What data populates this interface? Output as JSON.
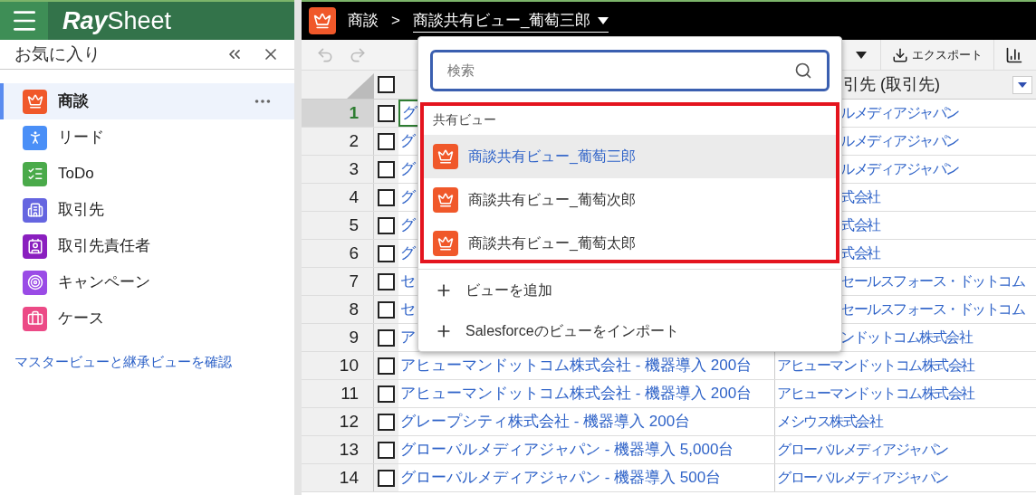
{
  "header": {
    "logo_bold": "Ray",
    "logo_light": "Sheet"
  },
  "sidebar": {
    "title": "お気に入り",
    "items": [
      {
        "label": "商談",
        "kind": "crown",
        "color": "#f0582a",
        "selected": true
      },
      {
        "label": "リード",
        "kind": "person",
        "color": "#4a8ff7",
        "selected": false
      },
      {
        "label": "ToDo",
        "kind": "checklist",
        "color": "#4aaa4a",
        "selected": false
      },
      {
        "label": "取引先",
        "kind": "building",
        "color": "#6565e0",
        "selected": false
      },
      {
        "label": "取引先責任者",
        "kind": "card",
        "color": "#8a1fbf",
        "selected": false
      },
      {
        "label": "キャンペーン",
        "kind": "target",
        "color": "#9a4be6",
        "selected": false
      },
      {
        "label": "ケース",
        "kind": "case",
        "color": "#ec4a86",
        "selected": false
      }
    ],
    "link": "マスタービューと継承ビューを確認"
  },
  "breadcrumb": {
    "object": "商談",
    "separator": ">",
    "view": "商談共有ビュー_葡萄三郎"
  },
  "toolbar": {
    "export": "エクスポート"
  },
  "grid": {
    "header_checked": false,
    "column_b": "引先 (取引先)",
    "rows": [
      {
        "number": "1",
        "selected": true,
        "checked": false,
        "cells": [
          "グ",
          "ルメディアジャパン"
        ]
      },
      {
        "number": "2",
        "selected": false,
        "checked": false,
        "cells": [
          "グ",
          "ルメディアジャパン"
        ]
      },
      {
        "number": "3",
        "selected": false,
        "checked": false,
        "cells": [
          "グ",
          "ルメディアジャパン"
        ]
      },
      {
        "number": "4",
        "selected": false,
        "checked": false,
        "cells": [
          "グ",
          "式会社"
        ]
      },
      {
        "number": "5",
        "selected": false,
        "checked": false,
        "cells": [
          "グ",
          "式会社"
        ]
      },
      {
        "number": "6",
        "selected": false,
        "checked": false,
        "cells": [
          "グ",
          "式会社"
        ]
      },
      {
        "number": "7",
        "selected": false,
        "checked": false,
        "cells": [
          "セ",
          "セールスフォース・ドットコム"
        ]
      },
      {
        "number": "8",
        "selected": false,
        "checked": false,
        "cells": [
          "セ",
          "セールスフォース・ドットコム"
        ]
      },
      {
        "number": "9",
        "selected": false,
        "checked": false,
        "cells": [
          "ア",
          "ンドットコム株式会社"
        ]
      },
      {
        "number": "10",
        "selected": false,
        "checked": false,
        "cells": [
          "アヒューマンドットコム株式会社 - 機器導入 200台",
          "アヒューマンドットコム株式会社"
        ]
      },
      {
        "number": "11",
        "selected": false,
        "checked": false,
        "cells": [
          "アヒューマンドットコム株式会社 - 機器導入 200台",
          "アヒューマンドットコム株式会社"
        ]
      },
      {
        "number": "12",
        "selected": false,
        "checked": false,
        "cells": [
          "グレープシティ株式会社 - 機器導入 200台",
          "メシウス株式会社"
        ]
      },
      {
        "number": "13",
        "selected": false,
        "checked": false,
        "cells": [
          "グローバルメディアジャパン - 機器導入 5,000台",
          "グローバルメディアジャパン"
        ]
      },
      {
        "number": "14",
        "selected": false,
        "checked": false,
        "cells": [
          "グローバルメディアジャパン - 機器導入 500台",
          "グローバルメディアジャパン"
        ]
      }
    ]
  },
  "dropdown": {
    "search_placeholder": "検索",
    "group": "共有ビュー",
    "views": [
      {
        "label": "商談共有ビュー_葡萄三郎",
        "selected": true
      },
      {
        "label": "商談共有ビュー_葡萄次郎",
        "selected": false
      },
      {
        "label": "商談共有ビュー_葡萄太郎",
        "selected": false
      }
    ],
    "actions": [
      "ビューを追加",
      "Salesforceのビューをインポート"
    ]
  }
}
